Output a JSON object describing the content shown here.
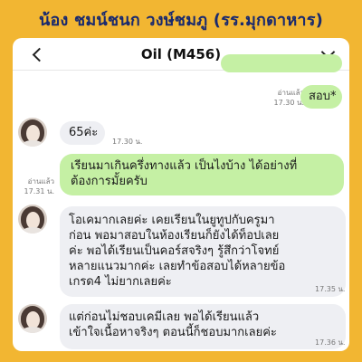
{
  "banner": {
    "text": "น้อง ชมน์ชนก วงษ์ชมภู (รร.มุกดาหาร)"
  },
  "header": {
    "title": "Oil (M456)"
  },
  "icons": {
    "back": "chevron-left-icon",
    "menu": "chevron-down-icon",
    "avatar": "avatar-photo"
  },
  "colors": {
    "background": "#f2b632",
    "banner_text": "#1a2a6e",
    "outgoing_bubble": "#c5f0a4",
    "incoming_bubble": "#eeeff3"
  },
  "messages": [
    {
      "side": "out",
      "text": "สอบ*",
      "status": "อ่านแล้ว",
      "time": "17.30 น."
    },
    {
      "side": "in",
      "text": "65ค่ะ",
      "time": "17.30 น."
    },
    {
      "side": "out",
      "lines": [
        "เรียนมาเกินครึ่งทางแล้ว เป็นไงบ้าง ได้อย่างที่",
        "ต้องการมั้ยครับ"
      ],
      "status": "อ่านแล้ว",
      "time": "17.31 น."
    },
    {
      "side": "in",
      "lines": [
        "โอเคมากเลยค่ะ เคยเรียนในยูทูปกับครูมา",
        "ก่อน พอมาสอบในห้องเรียนก็ยังได้ท็อปเลย",
        "ค่ะ พอได้เรียนเป็นคอร์สจริงๆ รู้สึกว่าโจทย์",
        "หลายแนวมากค่ะ เลยทำข้อสอบได้หลายข้อ",
        "เกรด4 ไม่ยากเลยค่ะ"
      ],
      "time": "17.35 น."
    },
    {
      "side": "in",
      "lines": [
        "แต่ก่อนไม่ชอบเคมีเลย พอได้เรียนแล้ว",
        "เข้าใจเนื้อหาจริงๆ ตอนนี้ก็ชอบมากเลยค่ะ"
      ],
      "time": "17.36 น."
    }
  ]
}
